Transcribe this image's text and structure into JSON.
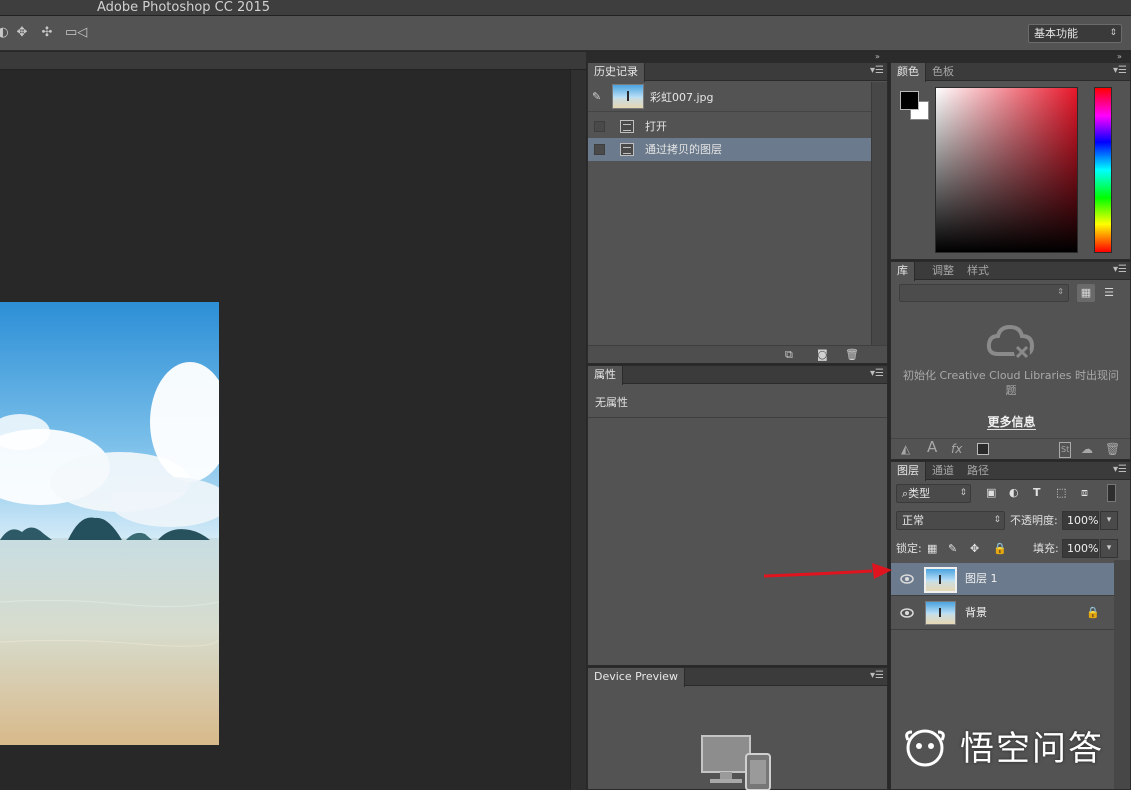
{
  "app": {
    "title": "Adobe Photoshop CC 2015",
    "workspace": "基本功能"
  },
  "history": {
    "tab": "历史记录",
    "snapshot": "彩虹007.jpg",
    "steps": [
      "打开",
      "通过拷贝的图层"
    ],
    "selected_step": 1
  },
  "properties": {
    "tab": "属性",
    "empty_text": "无属性"
  },
  "device_preview": {
    "tab": "Device Preview"
  },
  "color": {
    "tabs": [
      "颜色",
      "色板"
    ],
    "foreground": "#000000",
    "background": "#ffffff"
  },
  "libraries": {
    "tabs": [
      "库",
      "调整",
      "样式"
    ],
    "message": "初始化 Creative Cloud Libraries 时出现问题",
    "more_info": "更多信息"
  },
  "layers": {
    "tabs": [
      "图层",
      "通道",
      "路径"
    ],
    "filter_kind": "类型",
    "blend_mode": "正常",
    "opacity_label": "不透明度:",
    "opacity": "100%",
    "lock_label": "锁定:",
    "fill_label": "填充:",
    "fill": "100%",
    "items": [
      {
        "name": "图层 1",
        "selected": true,
        "locked": false
      },
      {
        "name": "背景",
        "selected": false,
        "locked": true
      }
    ]
  },
  "watermark": {
    "text": "悟空问答"
  },
  "colors": {
    "selection": "#6b7a8c",
    "panel": "#535353",
    "arrow": "#e0141e"
  }
}
